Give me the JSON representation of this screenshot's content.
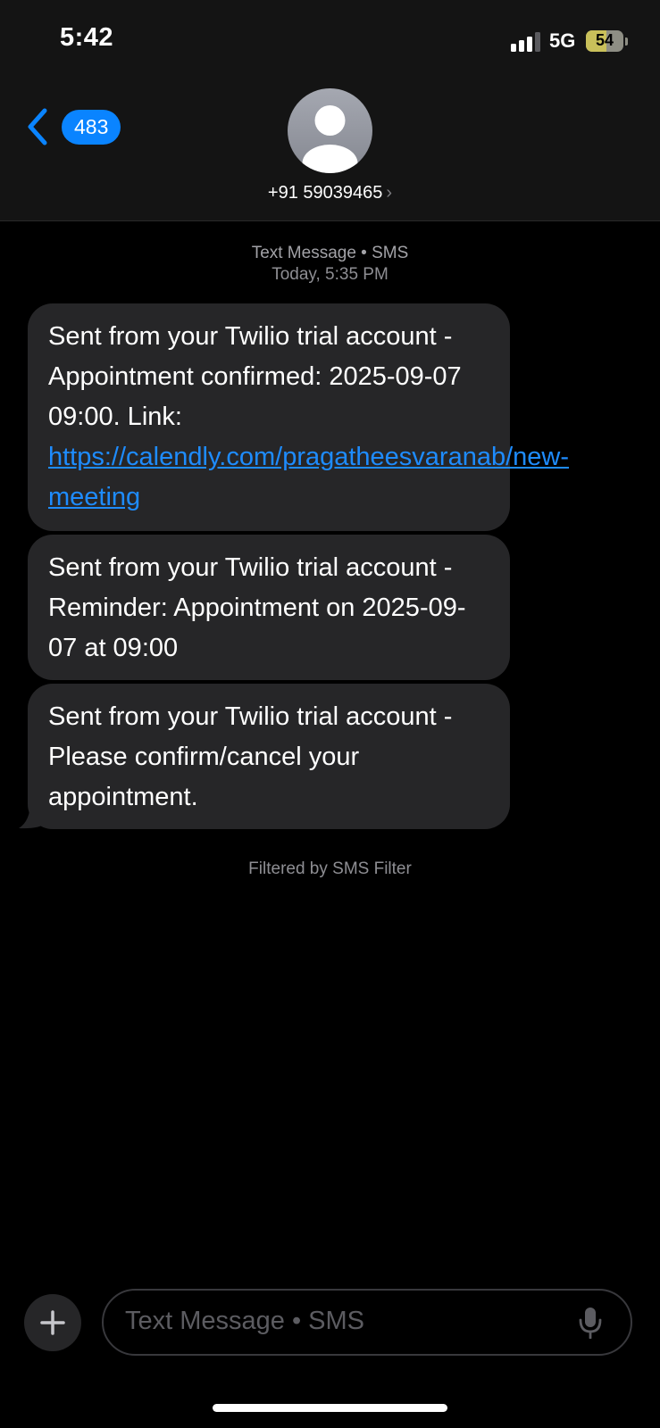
{
  "status_bar": {
    "time": "5:42",
    "network": "5G",
    "battery_level": "54",
    "battery_fraction": 0.54,
    "signal_bars_active": 3
  },
  "header": {
    "unread_count": "483",
    "contact": "+91 59039465",
    "chevron": "›"
  },
  "thread": {
    "service_label": "Text Message • SMS",
    "timestamp_day": "Today,",
    "timestamp_time": "5:35 PM"
  },
  "messages": [
    {
      "text_before_link": "Sent from your Twilio trial account - Appointment confirmed: 2025-09-07 09:00. Link: ",
      "link": "https://calendly.com/pragatheesvaranab/new-meeting"
    },
    {
      "text": "Sent from your Twilio trial account - Reminder: Appointment on 2025-09-07 at 09:00"
    },
    {
      "text": "Sent from your Twilio trial account - Please confirm/cancel your appointment."
    }
  ],
  "filter_note": "Filtered by SMS Filter",
  "compose": {
    "placeholder": "Text Message • SMS"
  },
  "icons": {
    "back": "back-chevron-icon",
    "avatar": "person-silhouette-icon",
    "add": "plus-icon",
    "dictation": "microphone-icon"
  },
  "colors": {
    "accent": "#0a84ff",
    "link": "#1e8cff",
    "bubble": "#262628",
    "background": "#000000"
  }
}
